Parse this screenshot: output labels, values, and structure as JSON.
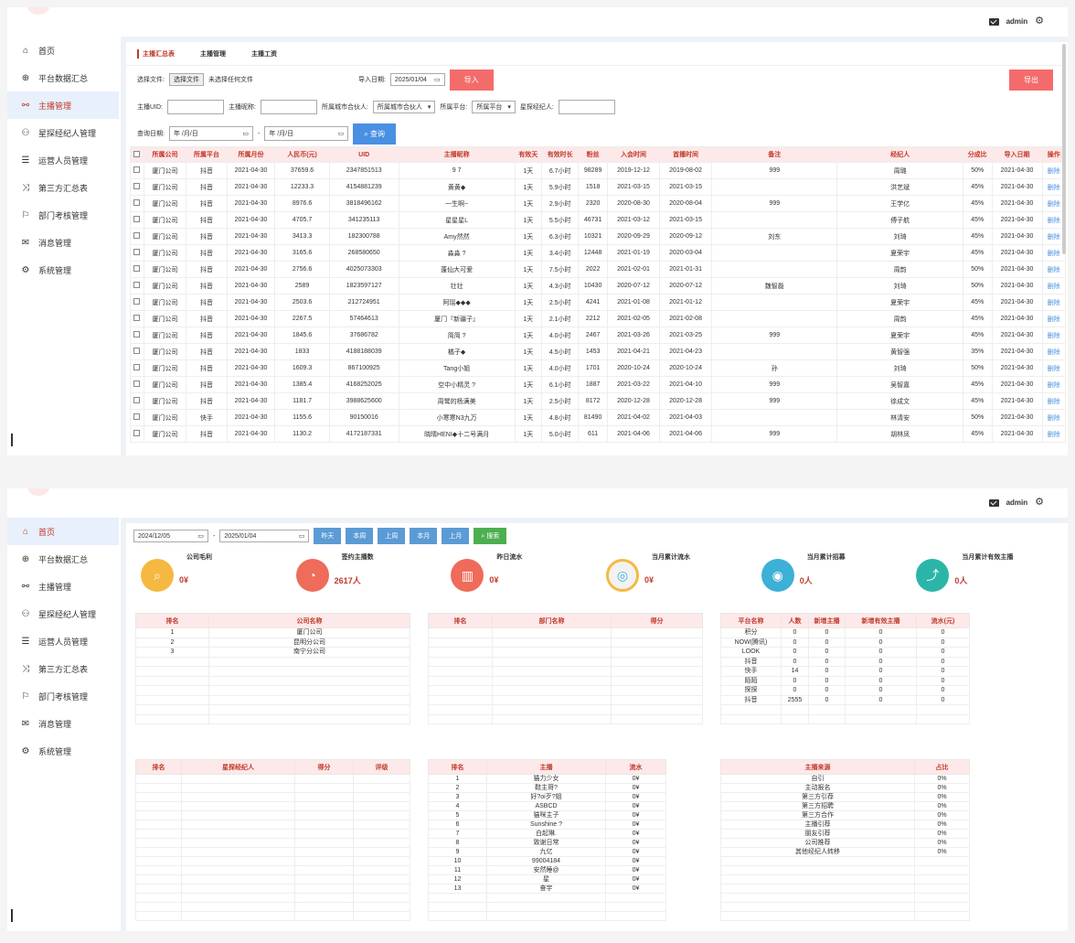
{
  "header": {
    "username": "admin",
    "mail_icon": "mail-icon",
    "gear_icon": "gear-icon"
  },
  "sidebar": {
    "items": [
      {
        "label": "首页",
        "icon": "home-icon",
        "glyph": "⌂"
      },
      {
        "label": "平台数据汇总",
        "icon": "chart-icon",
        "glyph": "⊕"
      },
      {
        "label": "主播管理",
        "icon": "users-icon",
        "glyph": "⚯"
      },
      {
        "label": "星探经纪人管理",
        "icon": "group-icon",
        "glyph": "⚇"
      },
      {
        "label": "运营人员管理",
        "icon": "list-icon",
        "glyph": "☰"
      },
      {
        "label": "第三方汇总表",
        "icon": "shuffle-icon",
        "glyph": "⤨"
      },
      {
        "label": "部门考核管理",
        "icon": "org-icon",
        "glyph": "⚐"
      },
      {
        "label": "消息管理",
        "icon": "message-icon",
        "glyph": "✉"
      },
      {
        "label": "系统管理",
        "icon": "cog-icon",
        "glyph": "⚙"
      }
    ]
  },
  "screen1": {
    "tabs": [
      "主播汇总表",
      "主播管理",
      "主播工资"
    ],
    "upload": {
      "label": "选择文件:",
      "button": "选择文件",
      "status": "未选择任何文件",
      "date_label": "导入日期:",
      "date_value": "2025/01/04",
      "import": "导入",
      "export": "导出"
    },
    "filters": {
      "uid_label": "主播UID:",
      "name_label": "主播昵称:",
      "partner_label": "所属城市合伙人:",
      "partner_value": "所属城市合伙人",
      "platform_label": "所属平台:",
      "platform_value": "所属平台",
      "agent_label": "星探经纪人:",
      "date_label": "查询日期:",
      "date_from": "年 /月/日",
      "date_to": "年 /月/日",
      "query": "查询"
    },
    "columns": [
      "所属公司",
      "所属平台",
      "所属月份",
      "人民币(元)",
      "UID",
      "主播昵称",
      "有效天",
      "有效时长",
      "粉丝",
      "入会时间",
      "首播时间",
      "备注",
      "经纪人",
      "分成比",
      "导入日期",
      "操作"
    ],
    "rows": [
      [
        "厦门公司",
        "抖音",
        "2021-04-30",
        "37659.6",
        "2347851513",
        "9 7",
        "1天",
        "6.7小时",
        "98289",
        "2019-12-12",
        "2019-08-02",
        "999",
        "周璐",
        "50%",
        "2021-04-30",
        "删除"
      ],
      [
        "厦门公司",
        "抖音",
        "2021-04-30",
        "12233.3",
        "4154881239",
        "黄黄◆",
        "1天",
        "5.9小时",
        "1518",
        "2021-03-15",
        "2021-03-15",
        "",
        "洪艺斌",
        "45%",
        "2021-04-30",
        "删除"
      ],
      [
        "厦门公司",
        "抖音",
        "2021-04-30",
        "8976.6",
        "3818496162",
        "一生啊~",
        "1天",
        "2.9小时",
        "2320",
        "2020-08-30",
        "2020-08-04",
        "999",
        "王学亿",
        "45%",
        "2021-04-30",
        "删除"
      ],
      [
        "厦门公司",
        "抖音",
        "2021-04-30",
        "4705.7",
        "341235113",
        "星星星L",
        "1天",
        "5.5小时",
        "46731",
        "2021-03-12",
        "2021-03-15",
        "",
        "傅子航",
        "45%",
        "2021-04-30",
        "删除"
      ],
      [
        "厦门公司",
        "抖音",
        "2021-04-30",
        "3413.3",
        "182300788",
        "Amy然然",
        "1天",
        "6.3小时",
        "10321",
        "2020-09-29",
        "2020-09-12",
        "刘东",
        "刘琦",
        "45%",
        "2021-04-30",
        "删除"
      ],
      [
        "厦门公司",
        "抖音",
        "2021-04-30",
        "3165.6",
        "268580650",
        "淼淼 ?​",
        "1天",
        "3.4小时",
        "12448",
        "2021-01-19",
        "2020-03-04",
        "",
        "夏荣宇",
        "45%",
        "2021-04-30",
        "删除"
      ],
      [
        "厦门公司",
        "抖音",
        "2021-04-30",
        "2756.6",
        "4025073303",
        "蓬仙大可爱",
        "1天",
        "7.5小时",
        "2022",
        "2021-02-01",
        "2021-01-31",
        "",
        "周韵",
        "50%",
        "2021-04-30",
        "删除"
      ],
      [
        "厦门公司",
        "抖音",
        "2021-04-30",
        "2589",
        "1823597127",
        "壮壮",
        "1天",
        "4.3小时",
        "10430",
        "2020-07-12",
        "2020-07-12",
        "魏智磊",
        "刘琦",
        "50%",
        "2021-04-30",
        "删除"
      ],
      [
        "厦门公司",
        "抖音",
        "2021-04-30",
        "2503.6",
        "212724951",
        "阿瑶◆◆◆",
        "1天",
        "2.5小时",
        "4241",
        "2021-01-08",
        "2021-01-12",
        "",
        "夏荣宇",
        "45%",
        "2021-04-30",
        "删除"
      ],
      [
        "厦门公司",
        "抖音",
        "2021-04-30",
        "2267.5",
        "57464613",
        "厦门『新疆子』",
        "1天",
        "2.1小时",
        "2212",
        "2021-02-05",
        "2021-02-08",
        "",
        "周韵",
        "45%",
        "2021-04-30",
        "删除"
      ],
      [
        "厦门公司",
        "抖音",
        "2021-04-30",
        "1845.6",
        "37686782",
        "简简 ?​",
        "1天",
        "4.0小时",
        "2467",
        "2021-03-26",
        "2021-03-25",
        "999",
        "夏荣宇",
        "45%",
        "2021-04-30",
        "删除"
      ],
      [
        "厦门公司",
        "抖音",
        "2021-04-30",
        "1833",
        "4188188039",
        "橘子◆",
        "1天",
        "4.5小时",
        "1453",
        "2021-04-21",
        "2021-04-23",
        "",
        "黄智强",
        "35%",
        "2021-04-30",
        "删除"
      ],
      [
        "厦门公司",
        "抖音",
        "2021-04-30",
        "1609.3",
        "867100925",
        "Tang小姐",
        "1天",
        "4.0小时",
        "1701",
        "2020-10-24",
        "2020-10-24",
        "孙",
        "刘琦",
        "50%",
        "2021-04-30",
        "删除"
      ],
      [
        "厦门公司",
        "抖音",
        "2021-04-30",
        "1385.4",
        "4168252025",
        "空中小精灵 ?​",
        "1天",
        "6.1小时",
        "1887",
        "2021-03-22",
        "2021-04-10",
        "999",
        "吴智嘉",
        "45%",
        "2021-04-30",
        "删除"
      ],
      [
        "厦门公司",
        "抖音",
        "2021-04-30",
        "1181.7",
        "3988625600",
        "周鹭的杨满美",
        "1天",
        "2.5小时",
        "8172",
        "2020-12-28",
        "2020-12-28",
        "999",
        "徐成文",
        "45%",
        "2021-04-30",
        "删除"
      ],
      [
        "厦门公司",
        "快手",
        "2021-04-30",
        "1155.6",
        "90150016",
        "小寒寒N3九万",
        "1天",
        "4.8小时",
        "81490",
        "2021-04-02",
        "2021-04-03",
        "",
        "林清安",
        "50%",
        "2021-04-30",
        "删除"
      ],
      [
        "厦门公司",
        "抖音",
        "2021-04-30",
        "1130.2",
        "4172187331",
        "晓晴HENI◆十二号满月",
        "1天",
        "5.0小时",
        "611",
        "2021-04-06",
        "2021-04-06",
        "999",
        "胡林凤",
        "45%",
        "2021-04-30",
        "删除"
      ]
    ]
  },
  "screen2": {
    "date_from": "2024/12/05",
    "date_to": "2025/01/04",
    "buttons": [
      "昨天",
      "本周",
      "上周",
      "本月",
      "上月"
    ],
    "search": "搜索",
    "stats": [
      {
        "title": "公司毛利",
        "value": "0¥",
        "color": "#f5b942",
        "icon": "magnifier-doc-icon",
        "glyph": "⌕"
      },
      {
        "title": "签约主播数",
        "value": "2617人",
        "color": "#ef6b5a",
        "icon": "pie-chart-icon",
        "glyph": "◔"
      },
      {
        "title": "昨日流水",
        "value": "0¥",
        "color": "#ef6b5a",
        "icon": "bar-chart-icon",
        "glyph": "▥"
      },
      {
        "title": "当月累计流水",
        "value": "0¥",
        "color": "#f2f2f2",
        "icon": "cycle-icon",
        "glyph": "◎"
      },
      {
        "title": "当月累计招募",
        "value": "0人",
        "color": "#3db0d6",
        "icon": "target-icon",
        "glyph": "◉"
      },
      {
        "title": "当月累计有效主播",
        "value": "0人",
        "color": "#2bb5a8",
        "icon": "trend-icon",
        "glyph": "⤴"
      }
    ],
    "company_table": {
      "columns": [
        "排名",
        "公司名称"
      ],
      "rows": [
        [
          "1",
          "厦门公司"
        ],
        [
          "2",
          "昆明分公司"
        ],
        [
          "3",
          "南宁分公司"
        ]
      ]
    },
    "dept_table": {
      "columns": [
        "排名",
        "部门名称",
        "得分"
      ]
    },
    "platform_table": {
      "columns": [
        "平台名称",
        "人数",
        "新增主播",
        "新增有效主播",
        "流水(元)"
      ],
      "rows": [
        [
          "积分",
          "0",
          "0",
          "0",
          "0"
        ],
        [
          "NOW(腾讯)",
          "0",
          "0",
          "0",
          "0"
        ],
        [
          "LOOK",
          "0",
          "0",
          "0",
          "0"
        ],
        [
          "抖音",
          "0",
          "0",
          "0",
          "0"
        ],
        [
          "快手",
          "14",
          "0",
          "0",
          "0"
        ],
        [
          "陌陌",
          "0",
          "0",
          "0",
          "0"
        ],
        [
          "探探",
          "0",
          "0",
          "0",
          "0"
        ],
        [
          "抖音",
          "2555",
          "0",
          "0",
          "0"
        ]
      ]
    },
    "agent_table": {
      "columns": [
        "排名",
        "星探经纪人",
        "得分",
        "评级"
      ]
    },
    "anchor_table": {
      "columns": [
        "排名",
        "主播",
        "流水"
      ],
      "rows": [
        [
          "1",
          "猫力少女",
          "0¥"
        ],
        [
          "2",
          "鞋主哥?",
          "0¥"
        ],
        [
          "3",
          "好?oi歹?姐",
          "0¥"
        ],
        [
          "4",
          "ASBCD",
          "0¥"
        ],
        [
          "5",
          "猫咪主子",
          "0¥"
        ],
        [
          "6",
          "Sunshine ?",
          "0¥"
        ],
        [
          "7",
          "白起琳.",
          "0¥"
        ],
        [
          "8",
          "致谢日常",
          "0¥"
        ],
        [
          "9",
          "九亿",
          "0¥"
        ],
        [
          "10",
          "99004184",
          "0¥"
        ],
        [
          "11",
          "安然睡@",
          "0¥"
        ],
        [
          "12",
          "星",
          "0¥"
        ],
        [
          "13",
          "奋宇",
          "0¥"
        ]
      ]
    },
    "source_table": {
      "columns": [
        "主播来源",
        "占比"
      ],
      "rows": [
        [
          "自引",
          "0%"
        ],
        [
          "主动报名",
          "0%"
        ],
        [
          "第三方引荐",
          "0%"
        ],
        [
          "第三方招聘",
          "0%"
        ],
        [
          "第三方合作",
          "0%"
        ],
        [
          "主播引荐",
          "0%"
        ],
        [
          "朋友引荐",
          "0%"
        ],
        [
          "公司推荐",
          "0%"
        ],
        [
          "其他经纪人转移",
          "0%"
        ]
      ]
    }
  }
}
